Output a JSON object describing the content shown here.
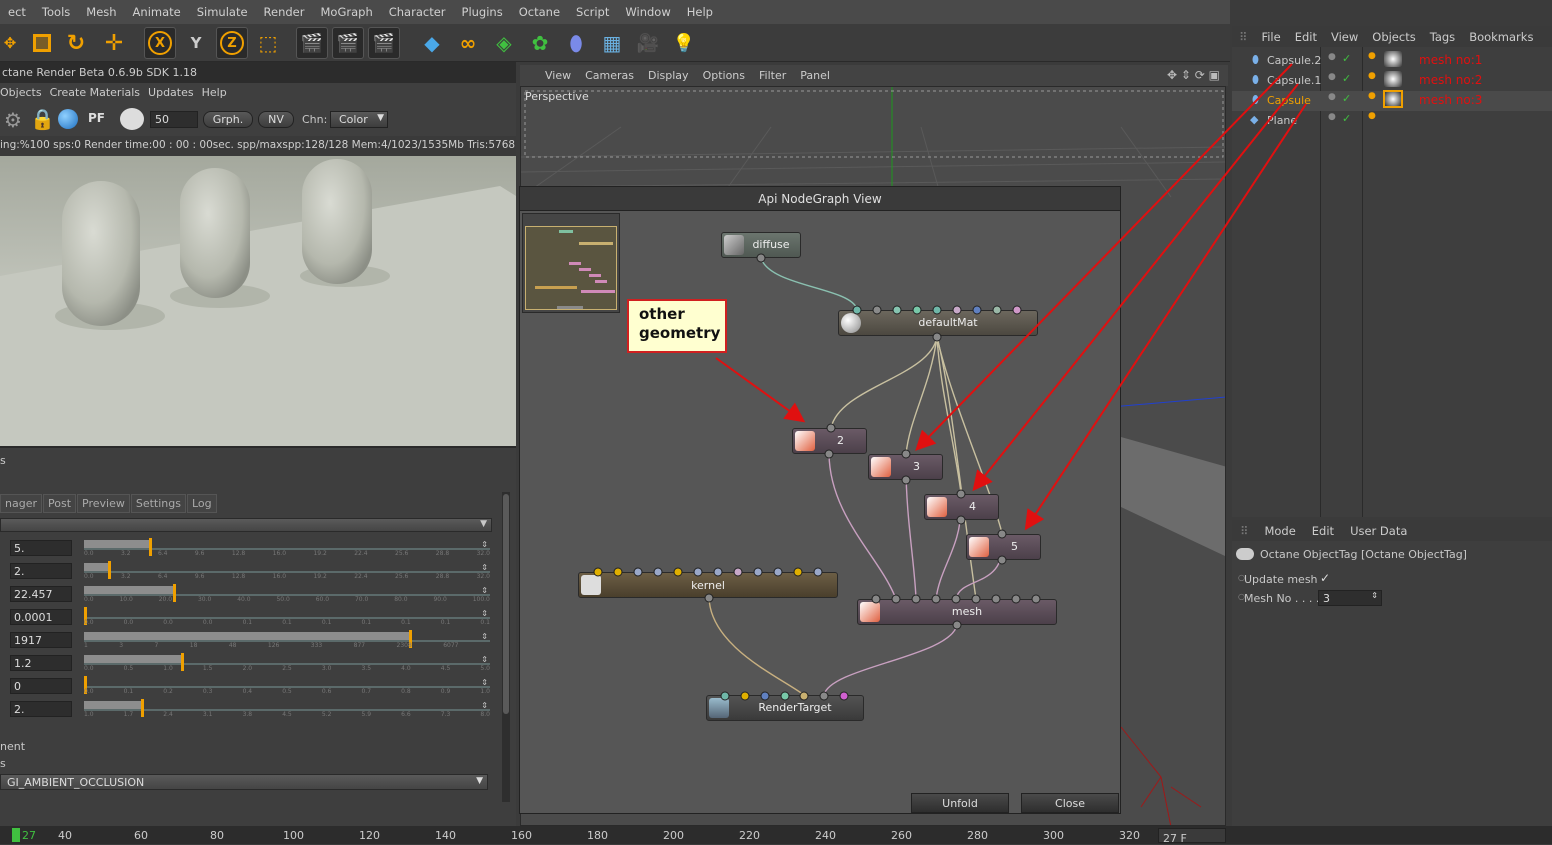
{
  "menubar": [
    "ect",
    "Tools",
    "Mesh",
    "Animate",
    "Simulate",
    "Render",
    "MoGraph",
    "Character",
    "Plugins",
    "Octane",
    "Script",
    "Window",
    "Help"
  ],
  "toolbar": {
    "icons": [
      "move-icon",
      "scale-icon",
      "rotate-icon",
      "add-icon",
      "x-axis-icon",
      "y-axis-icon",
      "z-axis-icon",
      "coord-icon",
      "render-view-icon",
      "render-picture-icon",
      "render-settings-icon",
      "cube-icon",
      "spline-icon",
      "nurbs-icon",
      "array-icon",
      "deformer-icon",
      "floor-icon",
      "camera-icon",
      "light-icon"
    ],
    "axis_x": "X",
    "axis_y": "Y",
    "axis_z": "Z"
  },
  "octane": {
    "title": "ctane Render Beta 0.6.9b   SDK 1.18",
    "menu": [
      "Objects",
      "Create Materials",
      "Updates",
      "Help"
    ],
    "tools": {
      "pf": "PF",
      "value": "50",
      "graph": "Grph.",
      "nv": "NV",
      "channel_label": "Chn:",
      "channel": "Color"
    },
    "status": "ing:%100 sps:0 Render time:00 : 00 : 00sec. spp/maxspp:128/128 Mem:4/1023/1535Mb Tris:5768 Mesh",
    "panel_label": "s",
    "tabs": [
      "nager",
      "Post",
      "Preview",
      "Settings",
      "Log"
    ],
    "params": [
      {
        "value": "5.",
        "fill": 0.16,
        "ticks": [
          "0.0",
          "3.2",
          "6.4",
          "9.6",
          "12.8",
          "16.0",
          "19.2",
          "22.4",
          "25.6",
          "28.8",
          "32.0"
        ]
      },
      {
        "value": "2.",
        "fill": 0.06,
        "ticks": [
          "0.0",
          "3.2",
          "6.4",
          "9.6",
          "12.8",
          "16.0",
          "19.2",
          "22.4",
          "25.6",
          "28.8",
          "32.0"
        ]
      },
      {
        "value": "22.457",
        "fill": 0.22,
        "ticks": [
          "0.0",
          "10.0",
          "20.0",
          "30.0",
          "40.0",
          "50.0",
          "60.0",
          "70.0",
          "80.0",
          "90.0",
          "100.0"
        ]
      },
      {
        "value": "0.0001",
        "fill": 0.0,
        "ticks": [
          "0.0",
          "0.0",
          "0.0",
          "0.0",
          "0.1",
          "0.1",
          "0.1",
          "0.1",
          "0.1",
          "0.1",
          "0.1"
        ]
      },
      {
        "value": "1917",
        "fill": 0.8,
        "ticks": [
          "1",
          "3",
          "7",
          "18",
          "48",
          "126",
          "333",
          "877",
          "2308",
          "6077",
          ""
        ]
      },
      {
        "value": "1.2",
        "fill": 0.24,
        "ticks": [
          "0.0",
          "0.5",
          "1.0",
          "1.5",
          "2.0",
          "2.5",
          "3.0",
          "3.5",
          "4.0",
          "4.5",
          "5.0"
        ]
      },
      {
        "value": "0",
        "fill": 0.0,
        "ticks": [
          "0.0",
          "0.1",
          "0.2",
          "0.3",
          "0.4",
          "0.5",
          "0.6",
          "0.7",
          "0.8",
          "0.9",
          "1.0"
        ]
      },
      {
        "value": "2.",
        "fill": 0.14,
        "ticks": [
          "1.0",
          "1.7",
          "2.4",
          "3.1",
          "3.8",
          "4.5",
          "5.2",
          "5.9",
          "6.6",
          "7.3",
          "8.0"
        ]
      }
    ],
    "label_ment": "nent",
    "label_s": "s",
    "gi_mode": "GI_AMBIENT_OCCLUSION"
  },
  "viewport": {
    "menu": [
      "View",
      "Cameras",
      "Display",
      "Options",
      "Filter",
      "Panel"
    ],
    "name": "Perspective"
  },
  "nodegraph": {
    "title": "Api NodeGraph View",
    "nodes": {
      "diffuse": "diffuse",
      "defaultMat": "defaultMat",
      "n2": "2",
      "n3": "3",
      "n4": "4",
      "n5": "5",
      "kernel": "kernel",
      "mesh": "mesh",
      "renderTarget": "RenderTarget"
    },
    "unfold": "Unfold",
    "close": "Close"
  },
  "callout": {
    "line1": "other",
    "line2": "geometry"
  },
  "objects": {
    "menu": [
      "File",
      "Edit",
      "View",
      "Objects",
      "Tags",
      "Bookmarks"
    ],
    "items": [
      {
        "name": "Capsule.2",
        "tag_label": "mesh no:1"
      },
      {
        "name": "Capsule.1",
        "tag_label": "mesh no:2"
      },
      {
        "name": "Capsule",
        "tag_label": "mesh no:3"
      },
      {
        "name": "Plane",
        "tag_label": ""
      }
    ]
  },
  "attributes": {
    "menu": [
      "Mode",
      "Edit",
      "User Data"
    ],
    "title": "Octane ObjectTag [Octane ObjectTag]",
    "update_mesh_label": "Update mesh",
    "update_mesh_check": "✓",
    "mesh_no_label": "Mesh No . . . .",
    "mesh_no_value": "3"
  },
  "timeline": {
    "current": "27",
    "labels": [
      "40",
      "60",
      "80",
      "100",
      "120",
      "140",
      "160",
      "180",
      "200",
      "220",
      "240",
      "260",
      "280",
      "300",
      "320"
    ],
    "frame_field": "27 F"
  },
  "colors": {
    "accent": "#f0a000",
    "arrow": "#e01010",
    "pin_colors": [
      "#6fb7a8",
      "#9ab8a6",
      "#86c4b0",
      "#78c8a8",
      "#c8a8c8",
      "#6080c0",
      "#b8a0c8",
      "#d098c8",
      "#e0b000"
    ]
  }
}
